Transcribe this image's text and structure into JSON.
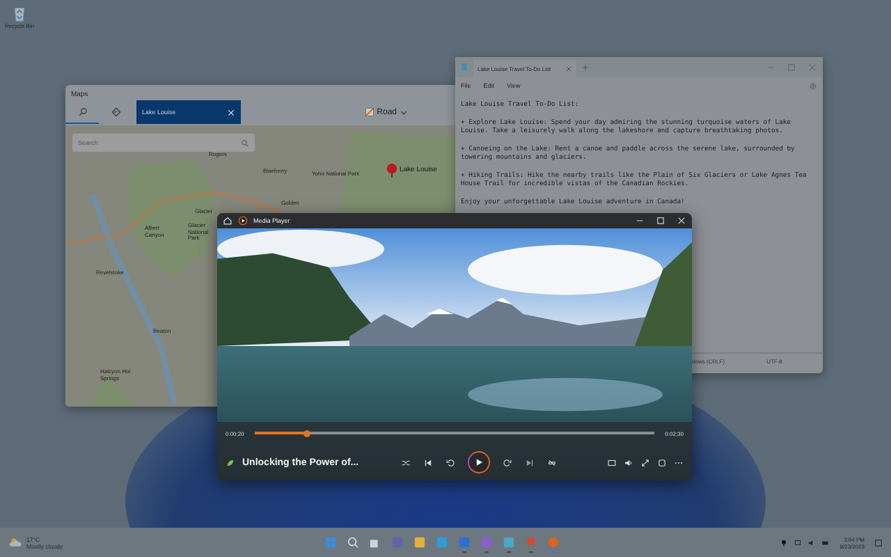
{
  "desktop": {
    "icons": [
      {
        "label": "Recycle Bin"
      }
    ]
  },
  "maps": {
    "title": "Maps",
    "tabs": [
      {
        "kind": "search",
        "selected": true
      },
      {
        "kind": "directions",
        "selected": false
      }
    ],
    "query": "Lake Louise",
    "layer": "Road",
    "search": {
      "placeholder": "Search"
    },
    "places": [
      {
        "label": "Rogers"
      },
      {
        "label": "Blaeberry"
      },
      {
        "label": "Golden"
      },
      {
        "label": "Yoho National Park"
      },
      {
        "label": "Glacier"
      },
      {
        "label": "Albert Canyon"
      },
      {
        "label": "Glacier National Park"
      },
      {
        "label": "Revelstoke"
      },
      {
        "label": "Beaton"
      },
      {
        "label": "Halcyon Hot Springs"
      }
    ],
    "pin_label": "Lake Louise"
  },
  "notepad": {
    "tab_title": "Lake Louise Travel To-Do List",
    "menu": [
      "File",
      "Edit",
      "View"
    ],
    "lines": [
      "Lake Louise Travel To-Do List:",
      "+ Explore Lake Louise: Spend your day admiring the stunning turquoise waters of Lake Louise. Take a leisurely walk along the lakeshore and capture breathtaking photos.",
      "+ Canoeing on the Lake: Rent a canoe and paddle across the serene lake, surrounded by towering mountains and glaciers.",
      "+ Hiking Trails: Hike the nearby trails like the Plain of Six Glaciers or Lake Agnes Tea House Trail for incredible vistas of the Canadian Rockies.",
      "Enjoy your unforgettable Lake Louise adventure in Canada!"
    ],
    "status": [
      "dows (CRLF)",
      "UTF-8"
    ]
  },
  "player": {
    "title": "Media Player",
    "video_title": "Unlocking the Power of...",
    "elapsed": "0:00:20",
    "total": "0:02:30",
    "level": 0.13,
    "playing": false
  },
  "taskbar": {
    "weather": {
      "temp": "17°C",
      "condition": "Mostly cloudy"
    },
    "apps": [
      {
        "kind": "start",
        "running": false
      },
      {
        "kind": "search",
        "running": false
      },
      {
        "kind": "taskview",
        "running": false
      },
      {
        "kind": "teams",
        "running": false
      },
      {
        "kind": "folder",
        "running": false
      },
      {
        "kind": "browser",
        "running": false
      },
      {
        "kind": "store",
        "running": true
      },
      {
        "kind": "studio",
        "running": true
      },
      {
        "kind": "notepad",
        "running": true
      },
      {
        "kind": "maps",
        "running": true
      },
      {
        "kind": "media",
        "running": true
      }
    ],
    "time": "3:04 PM",
    "date": "9/23/2023"
  }
}
